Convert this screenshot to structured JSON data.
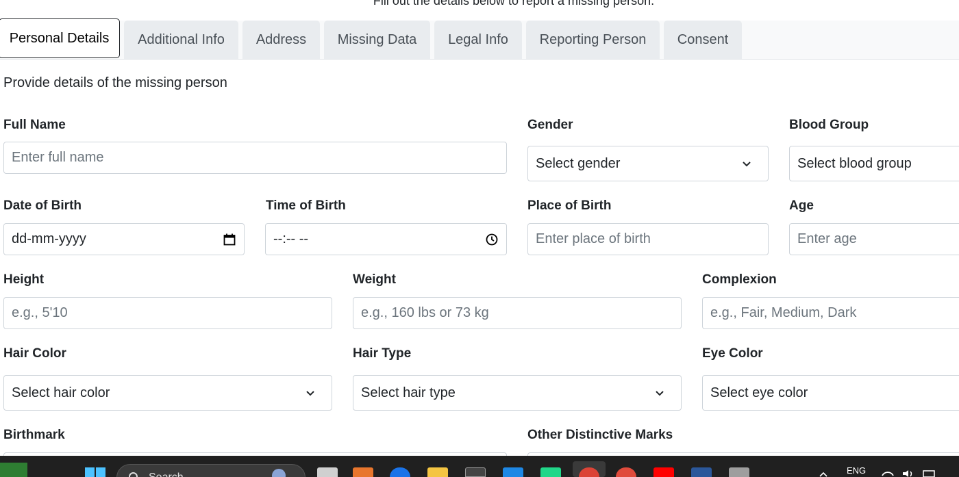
{
  "intro": "Fill out the details below to report a missing person.",
  "tabs": [
    {
      "label": "Personal Details",
      "active": true
    },
    {
      "label": "Additional Info"
    },
    {
      "label": "Address"
    },
    {
      "label": "Missing Data"
    },
    {
      "label": "Legal Info"
    },
    {
      "label": "Reporting Person"
    },
    {
      "label": "Consent"
    }
  ],
  "section_description": "Provide details of the missing person",
  "form": {
    "full_name": {
      "label": "Full Name",
      "placeholder": "Enter full name"
    },
    "gender": {
      "label": "Gender",
      "value": "Select gender"
    },
    "blood_group": {
      "label": "Blood Group",
      "value": "Select blood group"
    },
    "date_of_birth": {
      "label": "Date of Birth",
      "value": "dd-mm-yyyy"
    },
    "time_of_birth": {
      "label": "Time of Birth",
      "value": "--:-- --"
    },
    "place_of_birth": {
      "label": "Place of Birth",
      "placeholder": "Enter place of birth"
    },
    "age": {
      "label": "Age",
      "placeholder": "Enter age"
    },
    "height": {
      "label": "Height",
      "placeholder": "e.g., 5'10"
    },
    "weight": {
      "label": "Weight",
      "placeholder": "e.g., 160 lbs or 73 kg"
    },
    "complexion": {
      "label": "Complexion",
      "placeholder": "e.g., Fair, Medium, Dark"
    },
    "hair_color": {
      "label": "Hair Color",
      "value": "Select hair color"
    },
    "hair_type": {
      "label": "Hair Type",
      "value": "Select hair type"
    },
    "eye_color": {
      "label": "Eye Color",
      "value": "Select eye color"
    },
    "birthmark": {
      "label": "Birthmark"
    },
    "other_marks": {
      "label": "Other Distinctive Marks"
    }
  },
  "taskbar": {
    "search_label": "Search",
    "language": "ENG"
  },
  "colors": {
    "tab_inactive_bg": "#e9ecef",
    "border": "#ced4da",
    "text": "#212529",
    "placeholder": "#6c757d",
    "taskbar_bg": "#202020"
  }
}
